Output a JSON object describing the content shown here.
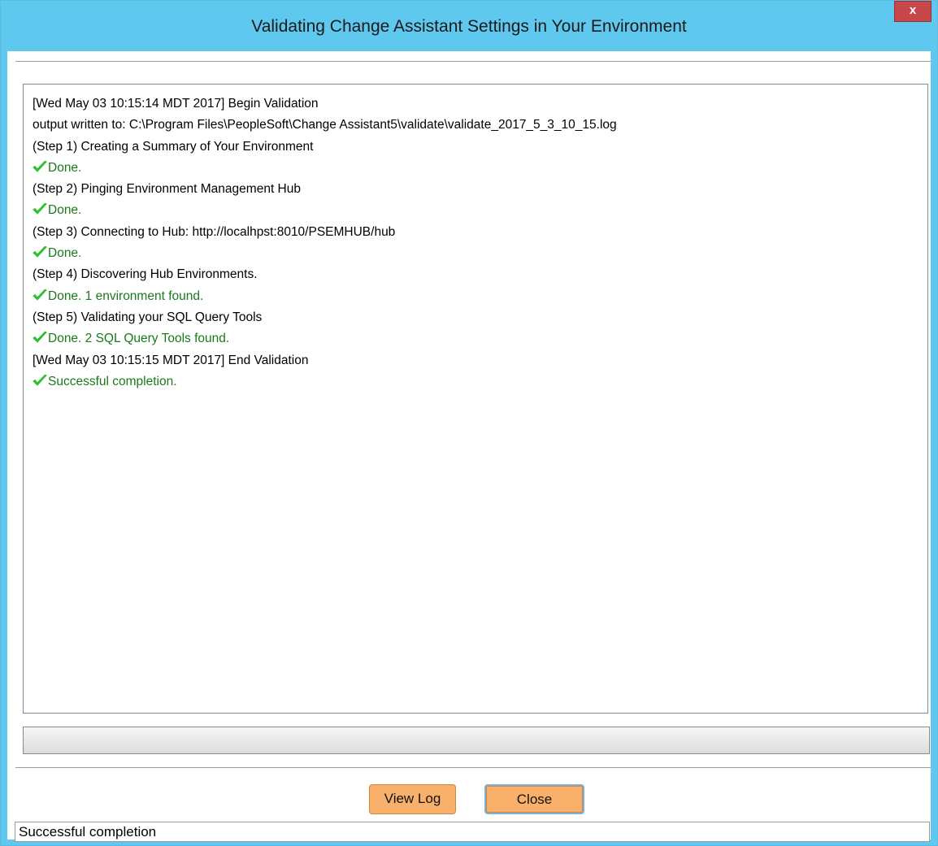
{
  "window": {
    "title": "Validating Change Assistant Settings in Your Environment",
    "close_glyph": "x"
  },
  "log": {
    "lines": [
      {
        "text": "[Wed May 03 10:15:14 MDT 2017] Begin Validation",
        "status": "normal"
      },
      {
        "text": "output written to: C:\\Program Files\\PeopleSoft\\Change Assistant5\\validate\\validate_2017_5_3_10_15.log",
        "status": "normal"
      },
      {
        "text": "(Step 1) Creating a Summary of Your Environment",
        "status": "normal"
      },
      {
        "text": "Done.",
        "status": "ok"
      },
      {
        "text": "(Step 2) Pinging Environment Management Hub",
        "status": "normal"
      },
      {
        "text": "Done.",
        "status": "ok"
      },
      {
        "text": "(Step 3) Connecting to Hub: http://localhpst:8010/PSEMHUB/hub",
        "status": "normal"
      },
      {
        "text": "Done.",
        "status": "ok"
      },
      {
        "text": "(Step 4) Discovering Hub Environments.",
        "status": "normal"
      },
      {
        "text": "Done.  1 environment found.",
        "status": "ok"
      },
      {
        "text": "(Step 5) Validating your SQL Query Tools",
        "status": "normal"
      },
      {
        "text": "Done.  2 SQL Query Tools found.",
        "status": "ok"
      },
      {
        "text": "[Wed May 03 10:15:15 MDT 2017] End Validation",
        "status": "normal"
      },
      {
        "text": "Successful completion.",
        "status": "ok"
      }
    ]
  },
  "progress": {
    "value": 0
  },
  "buttons": {
    "view_log": "View Log",
    "close": "Close"
  },
  "status_bar": {
    "text": "Successful completion"
  },
  "colors": {
    "titlebar": "#5fc8ef",
    "close_button": "#c8474a",
    "ok_text": "#1a7a1a",
    "check_icon": "#2fbf2f",
    "button": "#f9b06b"
  },
  "icons": {
    "ok": "checkmark-icon"
  }
}
